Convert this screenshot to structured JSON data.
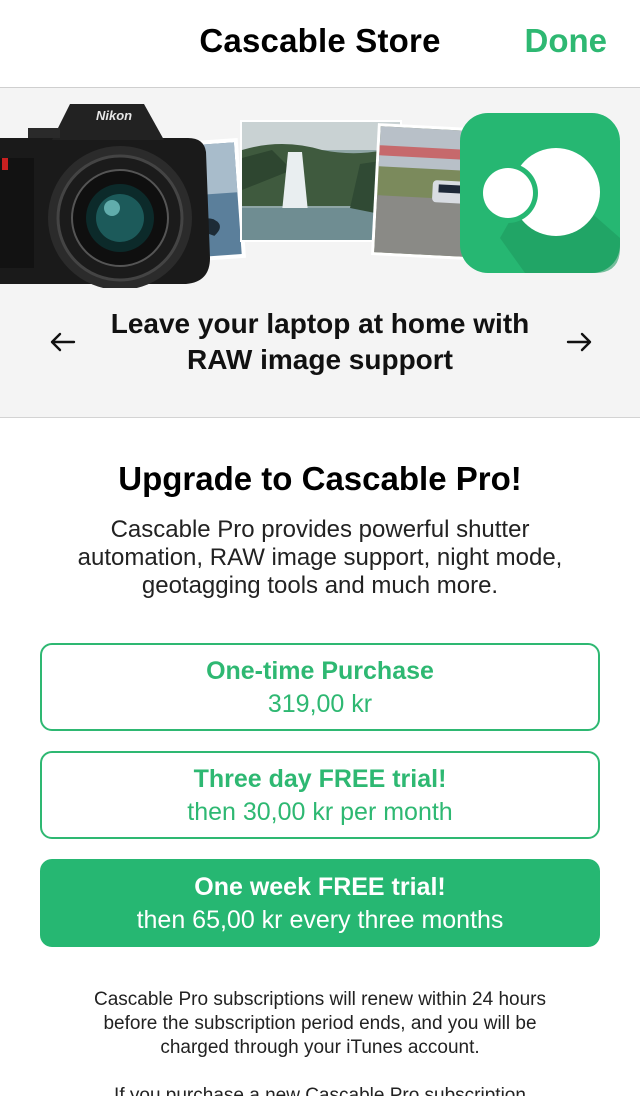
{
  "navbar": {
    "title": "Cascable Store",
    "done_label": "Done"
  },
  "hero": {
    "caption": "Leave your laptop at home with RAW image support",
    "camera_brand": "Nikon",
    "accent_color": "#2eb872",
    "prev_icon": "arrow-left-icon",
    "next_icon": "arrow-right-icon"
  },
  "upgrade": {
    "title": "Upgrade to Cascable Pro!",
    "description": "Cascable Pro provides powerful shutter automation, RAW image support, night mode, geotagging tools and much more."
  },
  "options": [
    {
      "title": "One-time Purchase",
      "subtitle": "319,00 kr",
      "selected": false
    },
    {
      "title": "Three day FREE trial!",
      "subtitle": "then 30,00 kr per month",
      "selected": false
    },
    {
      "title": "One week FREE trial!",
      "subtitle": "then 65,00 kr every three months",
      "selected": true
    }
  ],
  "legal": {
    "paragraph1": "Cascable Pro subscriptions will renew within 24 hours before the subscription period ends, and you will be charged through your iTunes account.",
    "paragraph2": "If you purchase a new Cascable Pro subscription"
  },
  "colors": {
    "brand_green": "#2eb872",
    "selected_fill": "#26b772",
    "hero_background": "#f4f4f4"
  }
}
